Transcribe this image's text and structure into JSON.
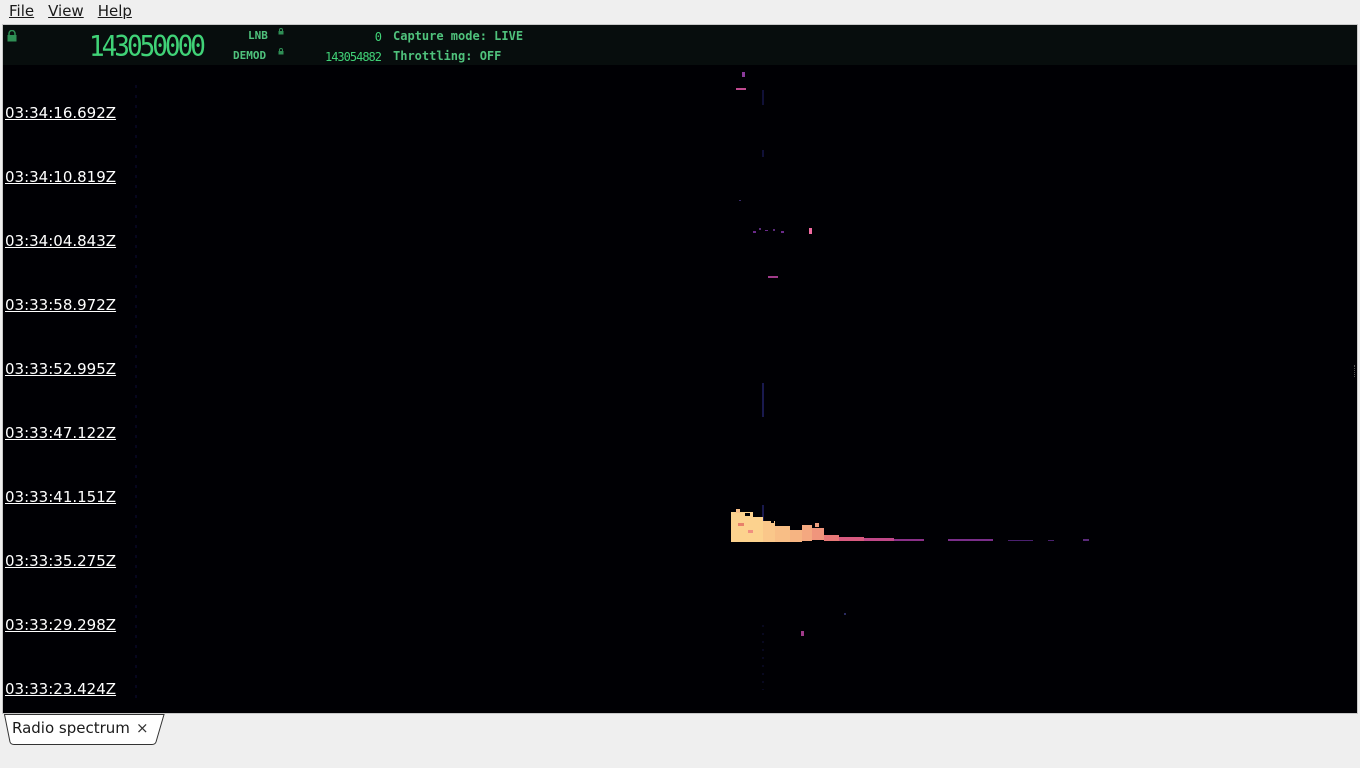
{
  "menu": {
    "file": "File",
    "view": "View",
    "help": "Help"
  },
  "header": {
    "frequency": "143050000",
    "lnb_label": "LNB",
    "lnb_value": "0",
    "demod_label": "DEMOD",
    "demod_value": "143054882",
    "capture_mode": "Capture mode: LIVE",
    "throttling": "Throttling: OFF"
  },
  "waterfall": {
    "timestamps": [
      "03:34:16.692Z",
      "03:34:10.819Z",
      "03:34:04.843Z",
      "03:33:58.972Z",
      "03:33:52.995Z",
      "03:33:47.122Z",
      "03:33:41.151Z",
      "03:33:35.275Z",
      "03:33:29.298Z",
      "03:33:23.424Z"
    ]
  },
  "tabs": [
    {
      "label": "Radio spectrum",
      "close": "×"
    }
  ],
  "colors": {
    "header_text": "#4fc27c",
    "waterfall_bg": "#000004",
    "signal_hot": "#fcd28e",
    "signal_mid": "#e0508a",
    "signal_low": "#6b2a8a"
  }
}
